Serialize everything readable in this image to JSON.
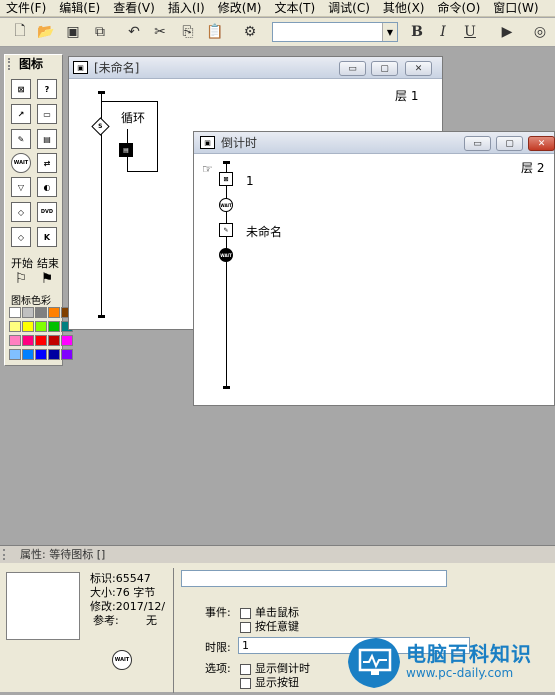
{
  "menu": [
    "文件(F)",
    "编辑(E)",
    "查看(V)",
    "插入(I)",
    "修改(M)",
    "文本(T)",
    "调试(C)",
    "其他(X)",
    "命令(O)",
    "窗口(W)"
  ],
  "toolbar": {
    "bold": "B",
    "italic": "I",
    "underline": "U"
  },
  "palette": {
    "title": "图标",
    "start_label": "开始",
    "end_label": "结束",
    "colors_label": "图标色彩",
    "swatches": [
      "#ffffff",
      "#c0c0c0",
      "#808080",
      "#ff8000",
      "#804000",
      "#ffff80",
      "#ffff00",
      "#80ff00",
      "#00c000",
      "#008080",
      "#ff80c0",
      "#ff0080",
      "#ff0000",
      "#c00000",
      "#ff00ff",
      "#80c0ff",
      "#0080ff",
      "#0000ff",
      "#0000a0",
      "#8000ff"
    ]
  },
  "main_window": {
    "title": "[未命名]",
    "layer": "层 1",
    "loop_label": "循环"
  },
  "countdown_window": {
    "title": "倒计时",
    "layer": "层 2",
    "icon1_label": "1",
    "icon2_label": "未命名"
  },
  "properties": {
    "header": "属性: 等待图标 []",
    "id_label": "标识:65547",
    "size_label": "大小:76 字节",
    "modified_label": "修改:2017/12/",
    "ref_label": "参考:",
    "ref_value": "无",
    "events_label": "事件:",
    "event_click": "单击鼠标",
    "event_key": "按任意键",
    "timeout_label": "时限:",
    "timeout_value": "1",
    "options_label": "选项:",
    "opt_countdown": "显示倒计时",
    "opt_button": "显示按钮"
  },
  "watermark": {
    "name": "电脑百科知识",
    "url": "www.pc-daily.com"
  }
}
